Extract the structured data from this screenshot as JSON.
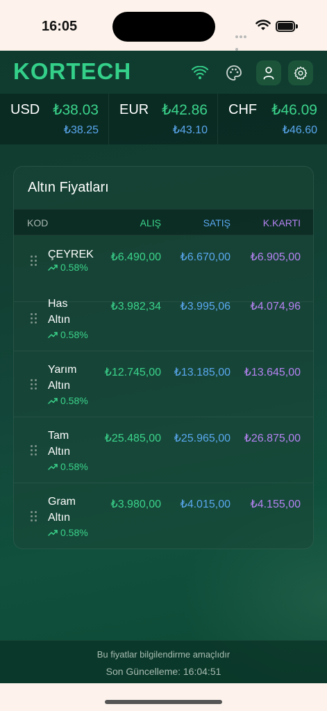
{
  "status_bar": {
    "time": "16:05"
  },
  "header": {
    "logo": "KORTECH"
  },
  "currencies": [
    {
      "code": "USD",
      "buy": "₺38.03",
      "sell": "₺38.25"
    },
    {
      "code": "EUR",
      "buy": "₺42.86",
      "sell": "₺43.10"
    },
    {
      "code": "CHF",
      "buy": "₺46.09",
      "sell": "₺46.60"
    }
  ],
  "gold_card": {
    "title": "Altın Fiyatları",
    "columns": {
      "code": "KOD",
      "buy": "ALIŞ",
      "sell": "SATIŞ",
      "card": "K.KARTI"
    },
    "rows": [
      {
        "name_line1": "ÇEYREK",
        "name_line2": "",
        "change": "0.58%",
        "buy": "₺6.490,00",
        "sell": "₺6.670,00",
        "card": "₺6.905,00"
      },
      {
        "name_line1": "Has",
        "name_line2": "Altın",
        "change": "0.58%",
        "buy": "₺3.982,34",
        "sell": "₺3.995,06",
        "card": "₺4.074,96"
      },
      {
        "name_line1": "Yarım",
        "name_line2": "Altın",
        "change": "0.58%",
        "buy": "₺12.745,00",
        "sell": "₺13.185,00",
        "card": "₺13.645,00"
      },
      {
        "name_line1": "Tam",
        "name_line2": "Altın",
        "change": "0.58%",
        "buy": "₺25.485,00",
        "sell": "₺25.965,00",
        "card": "₺26.875,00"
      },
      {
        "name_line1": "Gram",
        "name_line2": "Altın",
        "change": "0.58%",
        "buy": "₺3.980,00",
        "sell": "₺4.015,00",
        "card": "₺4.155,00"
      }
    ]
  },
  "footer": {
    "disclaimer": "Bu fiyatlar bilgilendirme amaçlıdır",
    "last_update": "Son Güncelleme: 16:04:51"
  },
  "colors": {
    "accent": "#34d08a",
    "buy": "#3bd48c",
    "sell": "#5aa8f0",
    "card": "#b583f2"
  },
  "icons": [
    "wifi-icon",
    "palette-icon",
    "user-icon",
    "gear-icon",
    "trend-up-icon",
    "drag-handle-icon"
  ]
}
